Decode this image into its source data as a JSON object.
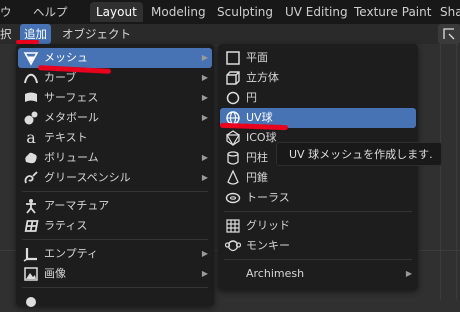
{
  "topbar": {
    "menu_edge": "ウ",
    "help": "ヘルプ",
    "workspaces": [
      "Layout",
      "Modeling",
      "Sculpting",
      "UV Editing",
      "Texture Paint",
      "Sha"
    ],
    "active_workspace": "Layout"
  },
  "header": {
    "select_edge": "択",
    "add": "追加",
    "object": "オブジェクト"
  },
  "add_menu": {
    "items": [
      {
        "label": "メッシュ",
        "icon": "mesh-cone-icon",
        "submenu": true
      },
      {
        "label": "カーブ",
        "icon": "curve-icon",
        "submenu": true
      },
      {
        "label": "サーフェス",
        "icon": "surface-icon",
        "submenu": true
      },
      {
        "label": "メタボール",
        "icon": "metaball-icon",
        "submenu": true
      },
      {
        "label": "テキスト",
        "icon": "text-icon",
        "submenu": false
      },
      {
        "label": "ボリューム",
        "icon": "volume-icon",
        "submenu": true
      },
      {
        "label": "グリースペンシル",
        "icon": "grease-pencil-icon",
        "submenu": true
      },
      {
        "label": "アーマチュア",
        "icon": "armature-icon",
        "submenu": false
      },
      {
        "label": "ラティス",
        "icon": "lattice-icon",
        "submenu": false
      },
      {
        "label": "エンプティ",
        "icon": "empty-icon",
        "submenu": true
      },
      {
        "label": "画像",
        "icon": "image-icon",
        "submenu": true
      }
    ]
  },
  "mesh_menu": {
    "items": [
      {
        "label": "平面",
        "icon": "plane-icon"
      },
      {
        "label": "立方体",
        "icon": "cube-icon"
      },
      {
        "label": "円",
        "icon": "circle-icon"
      },
      {
        "label": "UV球",
        "icon": "uv-sphere-icon"
      },
      {
        "label": "ICO球",
        "icon": "ico-sphere-icon"
      },
      {
        "label": "円柱",
        "icon": "cylinder-icon"
      },
      {
        "label": "円錐",
        "icon": "cone-icon"
      },
      {
        "label": "トーラス",
        "icon": "torus-icon"
      },
      {
        "label": "グリッド",
        "icon": "grid-icon"
      },
      {
        "label": "モンキー",
        "icon": "monkey-icon"
      },
      {
        "label": "Archimesh",
        "icon": "archimesh-icon"
      }
    ]
  },
  "tooltip": "UV 球メッシュを作成します.",
  "colors": {
    "highlight": "#4772b3",
    "annotation": "#e8001c",
    "menu_bg": "#1d1d1d"
  }
}
